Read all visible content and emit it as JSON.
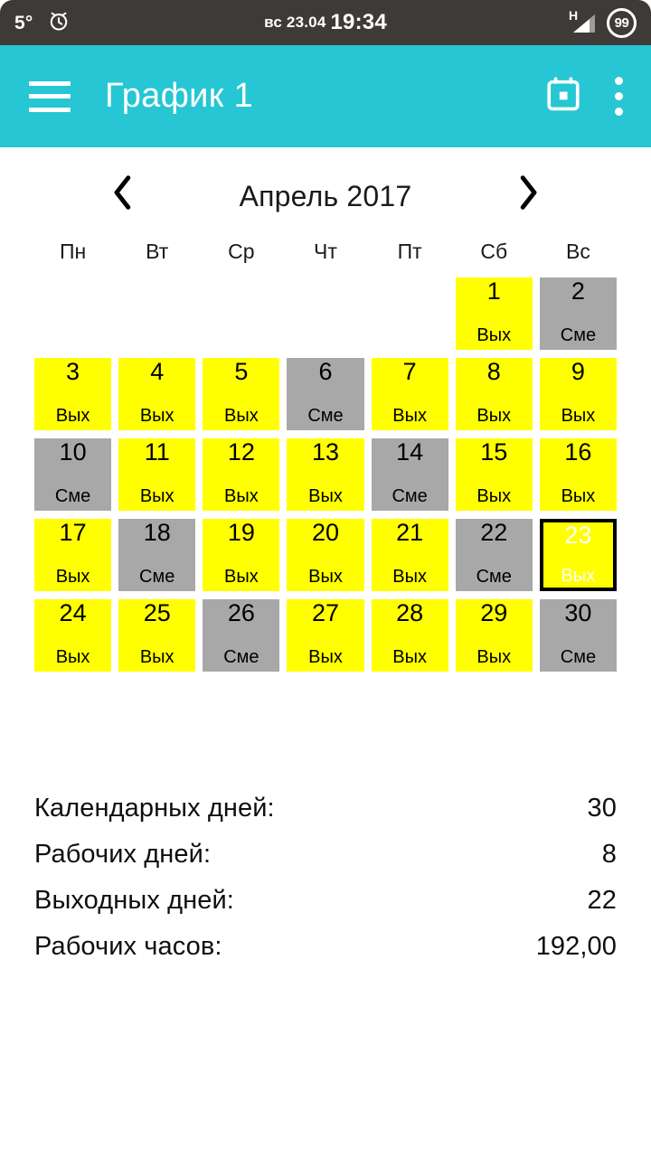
{
  "statusbar": {
    "temperature": "5°",
    "alarm_icon": "alarm-clock-icon",
    "date": "вс 23.04",
    "time": "19:34",
    "network_type": "H",
    "signal_icon": "signal-bars-icon",
    "battery_level": "99"
  },
  "appbar": {
    "menu_icon": "hamburger-menu-icon",
    "title": "График 1",
    "calendar_icon": "calendar-icon",
    "overflow_icon": "more-vertical-icon",
    "background_color": "#26c6d4"
  },
  "month_nav": {
    "prev_icon": "chevron-left-icon",
    "next_icon": "chevron-right-icon",
    "title": "Апрель 2017"
  },
  "calendar": {
    "weekdays": [
      "Пн",
      "Вт",
      "Ср",
      "Чт",
      "Пт",
      "Сб",
      "Вс"
    ],
    "legend": {
      "off_label": "Вых",
      "shift_label": "Сме",
      "off_color": "#ffff00",
      "shift_color": "#a8a8a8",
      "selected_border_color": "#000000",
      "selected_text_color": "#ffffff"
    },
    "selected_day": 23,
    "weeks": [
      [
        {
          "day": "",
          "label": "",
          "type": "empty"
        },
        {
          "day": "",
          "label": "",
          "type": "empty"
        },
        {
          "day": "",
          "label": "",
          "type": "empty"
        },
        {
          "day": "",
          "label": "",
          "type": "empty"
        },
        {
          "day": "",
          "label": "",
          "type": "empty"
        },
        {
          "day": "1",
          "label": "Вых",
          "type": "off"
        },
        {
          "day": "2",
          "label": "Сме",
          "type": "shift"
        }
      ],
      [
        {
          "day": "3",
          "label": "Вых",
          "type": "off"
        },
        {
          "day": "4",
          "label": "Вых",
          "type": "off"
        },
        {
          "day": "5",
          "label": "Вых",
          "type": "off"
        },
        {
          "day": "6",
          "label": "Сме",
          "type": "shift"
        },
        {
          "day": "7",
          "label": "Вых",
          "type": "off"
        },
        {
          "day": "8",
          "label": "Вых",
          "type": "off"
        },
        {
          "day": "9",
          "label": "Вых",
          "type": "off"
        }
      ],
      [
        {
          "day": "10",
          "label": "Сме",
          "type": "shift"
        },
        {
          "day": "11",
          "label": "Вых",
          "type": "off"
        },
        {
          "day": "12",
          "label": "Вых",
          "type": "off"
        },
        {
          "day": "13",
          "label": "Вых",
          "type": "off"
        },
        {
          "day": "14",
          "label": "Сме",
          "type": "shift"
        },
        {
          "day": "15",
          "label": "Вых",
          "type": "off"
        },
        {
          "day": "16",
          "label": "Вых",
          "type": "off"
        }
      ],
      [
        {
          "day": "17",
          "label": "Вых",
          "type": "off"
        },
        {
          "day": "18",
          "label": "Сме",
          "type": "shift"
        },
        {
          "day": "19",
          "label": "Вых",
          "type": "off"
        },
        {
          "day": "20",
          "label": "Вых",
          "type": "off"
        },
        {
          "day": "21",
          "label": "Вых",
          "type": "off"
        },
        {
          "day": "22",
          "label": "Сме",
          "type": "shift"
        },
        {
          "day": "23",
          "label": "Вых",
          "type": "off",
          "selected": true
        }
      ],
      [
        {
          "day": "24",
          "label": "Вых",
          "type": "off"
        },
        {
          "day": "25",
          "label": "Вых",
          "type": "off"
        },
        {
          "day": "26",
          "label": "Сме",
          "type": "shift"
        },
        {
          "day": "27",
          "label": "Вых",
          "type": "off"
        },
        {
          "day": "28",
          "label": "Вых",
          "type": "off"
        },
        {
          "day": "29",
          "label": "Вых",
          "type": "off"
        },
        {
          "day": "30",
          "label": "Сме",
          "type": "shift"
        }
      ]
    ]
  },
  "summary": [
    {
      "label": "Календарных дней:",
      "value": "30"
    },
    {
      "label": "Рабочих дней:",
      "value": "8"
    },
    {
      "label": "Выходных дней:",
      "value": "22"
    },
    {
      "label": "Рабочих часов:",
      "value": "192,00"
    }
  ]
}
